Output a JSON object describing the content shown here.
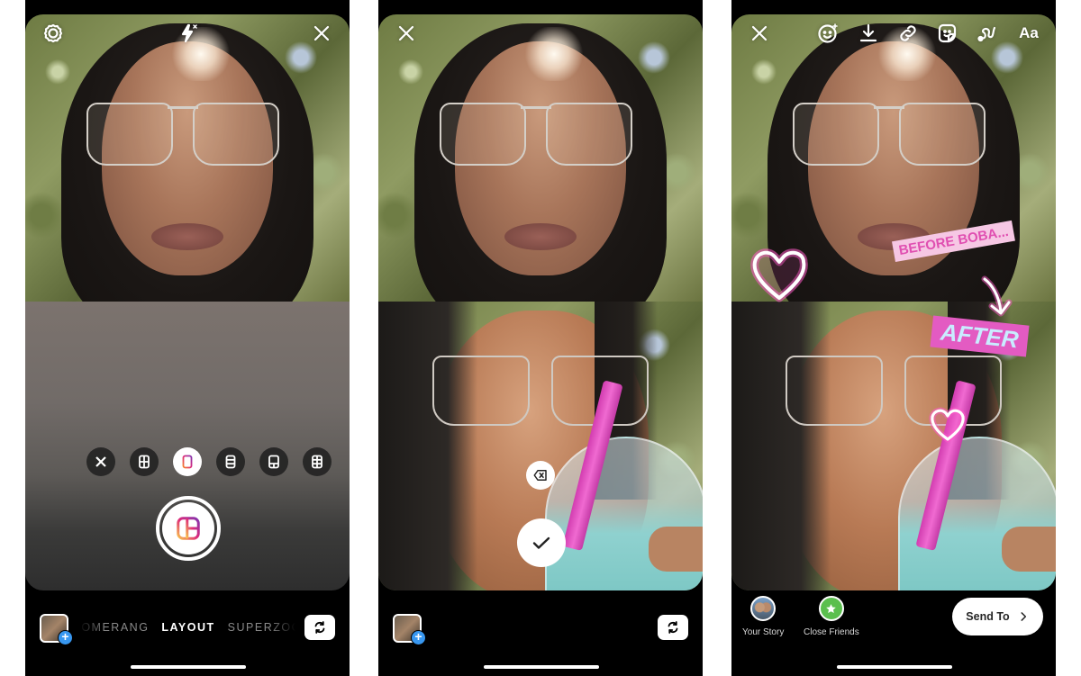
{
  "screens": [
    {
      "id": "camera-layout-mode",
      "top_icons": [
        "settings-icon",
        "flash-off-icon",
        "close-icon"
      ],
      "layout_options": [
        {
          "icon": "close-icon",
          "active": false
        },
        {
          "icon": "grid-2x2-icon",
          "active": false
        },
        {
          "icon": "split-2-vertical-icon",
          "active": true
        },
        {
          "icon": "split-3-vertical-icon",
          "active": false
        },
        {
          "icon": "split-top-large-icon",
          "active": false
        },
        {
          "icon": "grid-2x3-icon",
          "active": false
        }
      ],
      "shutter_icon": "layout-icon",
      "modes": [
        "BOOMERANG",
        "LAYOUT",
        "SUPERZOOM"
      ],
      "active_mode": "LAYOUT",
      "gallery_add_icon": "+",
      "flip_camera_icon": "flip-camera-icon"
    },
    {
      "id": "layout-captured",
      "top_icons": [
        "close-icon"
      ],
      "delete_icon": "delete-backspace-icon",
      "confirm_icon": "checkmark-icon",
      "gallery_add_icon": "+",
      "flip_camera_icon": "flip-camera-icon"
    },
    {
      "id": "story-edit",
      "top_icons": [
        "close-icon",
        "face-effects-icon",
        "download-icon",
        "link-icon",
        "sticker-icon",
        "draw-icon"
      ],
      "text_tool_label": "Aa",
      "stickers": {
        "before_text": "BEFORE BOBA...",
        "after_text": "AFTER",
        "heart_color": "#ff5ac8"
      },
      "share_targets": [
        {
          "label": "Your Story",
          "icon": "avatar"
        },
        {
          "label": "Close Friends",
          "icon": "star-icon",
          "color": "#5bbf4e"
        }
      ],
      "send_button": {
        "label": "Send To",
        "icon": "chevron-right-icon"
      }
    }
  ],
  "colors": {
    "accent_blue": "#3897f0",
    "instagram_gradient": [
      "#f58529",
      "#dd2a7b",
      "#8134af"
    ]
  }
}
